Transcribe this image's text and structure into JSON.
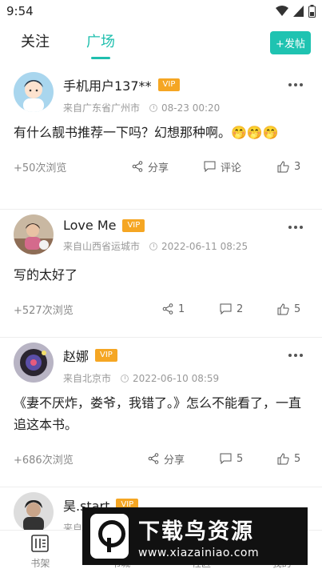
{
  "status_bar": {
    "time": "9:54"
  },
  "tabs": {
    "follow": "关注",
    "square": "广场"
  },
  "post_button": "+发帖",
  "posts": [
    {
      "user": "手机用户137**",
      "vip": "VIP",
      "location": "来自广东省广州市",
      "time": "08-23 00:20",
      "content": "有什么靓书推荐一下吗？幻想那种啊。🤭🤭🤭",
      "views": "+50次浏览",
      "share": "分享",
      "comment": "评论",
      "likes": "3"
    },
    {
      "user": "Love Me",
      "vip": "VIP",
      "location": "来自山西省运城市",
      "time": "2022-06-11 08:25",
      "content": "写的太好了",
      "views": "+527次浏览",
      "share": "1",
      "comment": "2",
      "likes": "5"
    },
    {
      "user": "赵娜",
      "vip": "VIP",
      "location": "来自北京市",
      "time": "2022-06-10 08:59",
      "content": "《妻不厌炸，娄爷，我错了。》怎么不能看了，一直追这本书。",
      "views": "+686次浏览",
      "share": "分享",
      "comment": "5",
      "likes": "5"
    },
    {
      "user": "昊.start",
      "vip": "VIP",
      "location": "来自",
      "time": "",
      "content": "",
      "views": "",
      "share": "",
      "comment": "",
      "likes": ""
    }
  ],
  "bottom_nav": [
    "书架",
    "书城",
    "社区",
    "我的"
  ],
  "watermark": {
    "title": "下载鸟资源",
    "url": "www.xiazainiao.com"
  },
  "colors": {
    "accent": "#1fbfae",
    "vip": "#f5a623"
  }
}
